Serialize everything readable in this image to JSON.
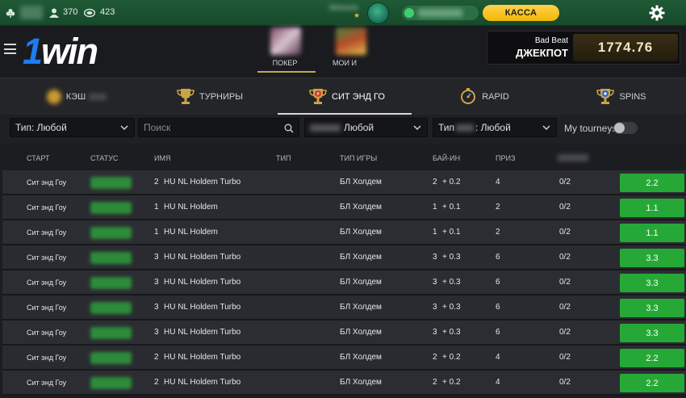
{
  "topbar": {
    "count1": "370",
    "count2": "423",
    "cashier_label": "КАССА"
  },
  "header": {
    "logo_prefix": "1",
    "logo_suffix": "win",
    "game_tabs": [
      {
        "label": "ПОКЕР",
        "active": true
      },
      {
        "label": "МОИ И"
      }
    ],
    "jackpot": {
      "title": "Bad Beat",
      "subtitle": "ДЖЕКПОТ",
      "value": "1774.76"
    }
  },
  "poker_tabs": [
    {
      "label": "КЭШ",
      "icon": "chip-icon"
    },
    {
      "label": "ТУРНИРЫ",
      "icon": "trophy-icon"
    },
    {
      "label": "СИТ ЭНД ГО",
      "icon": "trophy-bolt-icon",
      "active": true
    },
    {
      "label": "RAPID",
      "icon": "stopwatch-icon"
    },
    {
      "label": "SPINS",
      "icon": "spins-trophy-icon"
    }
  ],
  "filters": {
    "type_select": "Тип: Любой",
    "search_placeholder": "Поиск",
    "game_select": "Любой",
    "type2_select_prefix": "Тип",
    "type2_select_value": ": Любой",
    "my_tourneys_label": "My tourneys"
  },
  "table": {
    "headers": [
      "СТАРТ",
      "СТАТУС",
      "ИМЯ",
      "ТИП",
      "ТИП ИГРЫ",
      "БАЙ-ИН",
      "ПРИЗ"
    ],
    "rows": [
      {
        "start": "Сит энд Гоу",
        "seats": "2",
        "name": "HU NL Holdem Turbo",
        "game": "БЛ Холдем",
        "buyin_base": "2",
        "buyin_fee": "+ 0.2",
        "prize": "4",
        "players": "0/2",
        "button": "2.2"
      },
      {
        "start": "Сит энд Гоу",
        "seats": "1",
        "name": "HU NL Holdem",
        "game": "БЛ Холдем",
        "buyin_base": "1",
        "buyin_fee": "+ 0.1",
        "prize": "2",
        "players": "0/2",
        "button": "1.1"
      },
      {
        "start": "Сит энд Гоу",
        "seats": "1",
        "name": "HU NL Holdem",
        "game": "БЛ Холдем",
        "buyin_base": "1",
        "buyin_fee": "+ 0.1",
        "prize": "2",
        "players": "0/2",
        "button": "1.1"
      },
      {
        "start": "Сит энд Гоу",
        "seats": "3",
        "name": "HU NL Holdem Turbo",
        "game": "БЛ Холдем",
        "buyin_base": "3",
        "buyin_fee": "+ 0.3",
        "prize": "6",
        "players": "0/2",
        "button": "3.3"
      },
      {
        "start": "Сит энд Гоу",
        "seats": "3",
        "name": "HU NL Holdem Turbo",
        "game": "БЛ Холдем",
        "buyin_base": "3",
        "buyin_fee": "+ 0.3",
        "prize": "6",
        "players": "0/2",
        "button": "3.3"
      },
      {
        "start": "Сит энд Гоу",
        "seats": "3",
        "name": "HU NL Holdem Turbo",
        "game": "БЛ Холдем",
        "buyin_base": "3",
        "buyin_fee": "+ 0.3",
        "prize": "6",
        "players": "0/2",
        "button": "3.3"
      },
      {
        "start": "Сит энд Гоу",
        "seats": "3",
        "name": "HU NL Holdem Turbo",
        "game": "БЛ Холдем",
        "buyin_base": "3",
        "buyin_fee": "+ 0.3",
        "prize": "6",
        "players": "0/2",
        "button": "3.3"
      },
      {
        "start": "Сит энд Гоу",
        "seats": "2",
        "name": "HU NL Holdem Turbo",
        "game": "БЛ Холдем",
        "buyin_base": "2",
        "buyin_fee": "+ 0.2",
        "prize": "4",
        "players": "0/2",
        "button": "2.2"
      },
      {
        "start": "Сит энд Гоу",
        "seats": "2",
        "name": "HU NL Holdem Turbo",
        "game": "БЛ Холдем",
        "buyin_base": "2",
        "buyin_fee": "+ 0.2",
        "prize": "4",
        "players": "0/2",
        "button": "2.2"
      }
    ]
  },
  "colors": {
    "accent_gold": "#f2b705",
    "play_green": "#26a836",
    "topbar_green": "#1f5a35",
    "logo_blue": "#1e7cf0"
  }
}
